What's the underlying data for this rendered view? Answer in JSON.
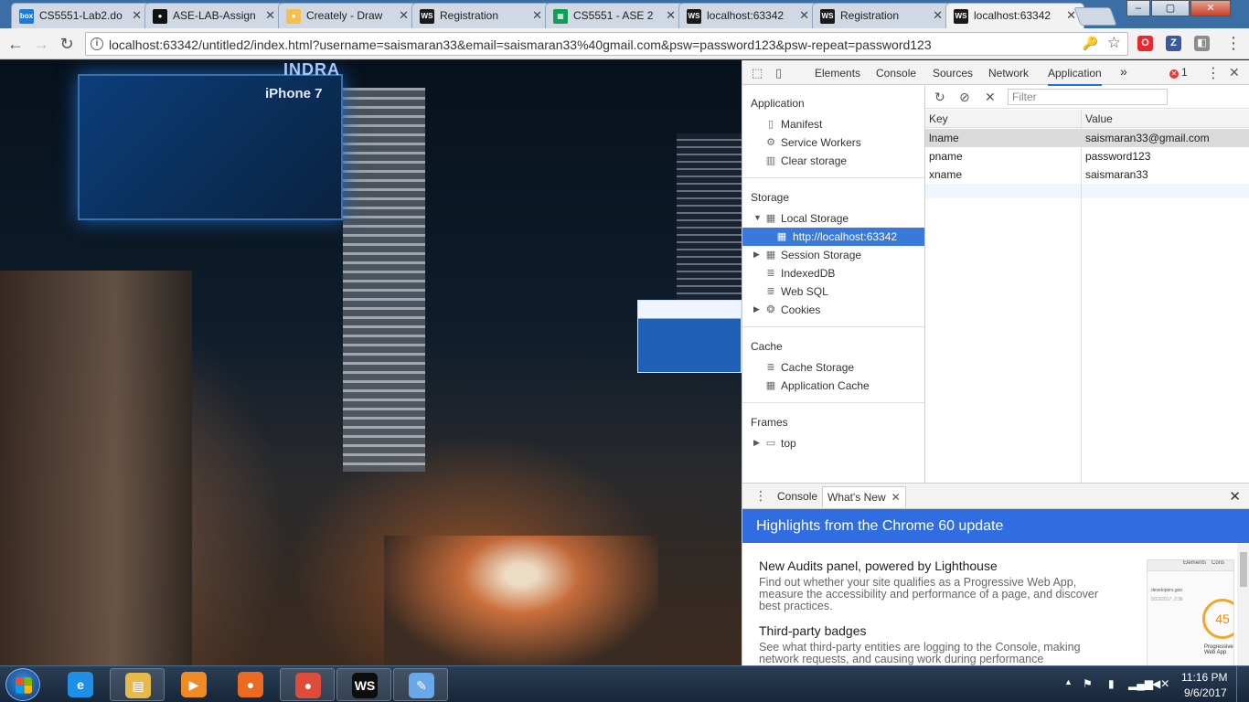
{
  "browser": {
    "tabs": [
      {
        "title": "CS5551-Lab2.do",
        "favicon": "box-icon",
        "color": "#1a7bd6",
        "glyph": "box",
        "active": false
      },
      {
        "title": "ASE-LAB-Assign",
        "favicon": "github-icon",
        "color": "#111111",
        "glyph": "●",
        "active": false
      },
      {
        "title": "Creately - Draw",
        "favicon": "creately-icon",
        "color": "#f2c14e",
        "glyph": "●",
        "active": false
      },
      {
        "title": "Registration",
        "favicon": "webstorm-icon",
        "color": "#1a1a1a",
        "glyph": "WS",
        "active": false
      },
      {
        "title": "CS5551 - ASE 2",
        "favicon": "sheets-icon",
        "color": "#0f9d58",
        "glyph": "▦",
        "active": false
      },
      {
        "title": "localhost:63342",
        "favicon": "webstorm-icon",
        "color": "#1a1a1a",
        "glyph": "WS",
        "active": false
      },
      {
        "title": "Registration",
        "favicon": "webstorm-icon",
        "color": "#1a1a1a",
        "glyph": "WS",
        "active": false
      },
      {
        "title": "localhost:63342",
        "favicon": "webstorm-icon",
        "color": "#1a1a1a",
        "glyph": "WS",
        "active": true
      }
    ],
    "url": "localhost:63342/untitled2/index.html?username=saismaran33&email=saismaran33%40gmail.com&psw=password123&psw-repeat=password123",
    "extensions": [
      {
        "name": "opera-icon",
        "glyph": "O",
        "color": "#e8282d"
      },
      {
        "name": "zotero-icon",
        "glyph": "Z",
        "color": "#3b5998"
      },
      {
        "name": "extension-icon",
        "glyph": "◧",
        "color": "#8c8c8c"
      }
    ]
  },
  "page": {
    "billboard_text": "iPhone 7",
    "building_sign": "INDRA"
  },
  "devtools": {
    "tabs": [
      "Elements",
      "Console",
      "Sources",
      "Network",
      "Application"
    ],
    "active_tab": "Application",
    "more_tabs": "»",
    "error_count": "1",
    "sidebar": {
      "application_header": "Application",
      "application_items": [
        {
          "label": "Manifest",
          "icon": "manifest-icon",
          "glyph": "▯"
        },
        {
          "label": "Service Workers",
          "icon": "gear-icon",
          "glyph": "⚙"
        },
        {
          "label": "Clear storage",
          "icon": "trash-icon",
          "glyph": "🗑"
        }
      ],
      "storage_header": "Storage",
      "local_storage": "Local Storage",
      "local_storage_origin": "http://localhost:63342",
      "session_storage": "Session Storage",
      "indexeddb": "IndexedDB",
      "websql": "Web SQL",
      "cookies": "Cookies",
      "cache_header": "Cache",
      "cache_storage": "Cache Storage",
      "application_cache": "Application Cache",
      "frames_header": "Frames",
      "frames_top": "top"
    },
    "storage_table": {
      "filter_placeholder": "Filter",
      "columns": [
        "Key",
        "Value"
      ],
      "rows": [
        {
          "key": "lname",
          "value": "saismaran33@gmail.com"
        },
        {
          "key": "pname",
          "value": "password123"
        },
        {
          "key": "xname",
          "value": "saismaran33"
        }
      ]
    },
    "drawer": {
      "tabs": [
        "Console",
        "What's New"
      ],
      "active_tab": "What's New",
      "banner": "Highlights from the Chrome 60 update",
      "items": [
        {
          "title": "New Audits panel, powered by Lighthouse",
          "text": "Find out whether your site qualifies as a Progressive Web App, measure the accessibility and performance of a page, and discover best practices."
        },
        {
          "title": "Third-party badges",
          "text": "See what third-party entities are logging to the Console, making network requests, and causing work during performance"
        }
      ],
      "thumb_tab": "Elements",
      "thumb_tab2": "Cons",
      "thumb_url": "developers.goo",
      "thumb_date": "5/23/2017, 2:36",
      "thumb_score": "45",
      "thumb_caption": "Progressive Web App"
    }
  },
  "taskbar": {
    "apps": [
      {
        "name": "internet-explorer-icon",
        "glyph": "e",
        "color": "#1f8fe6",
        "open": false
      },
      {
        "name": "file-explorer-icon",
        "glyph": "▤",
        "color": "#e5b94a",
        "open": true
      },
      {
        "name": "media-player-icon",
        "glyph": "▶",
        "color": "#f08a24",
        "open": false
      },
      {
        "name": "firefox-icon",
        "glyph": "●",
        "color": "#ea6a1f",
        "open": false
      },
      {
        "name": "chrome-icon",
        "glyph": "●",
        "color": "#dd4b39",
        "open": true
      },
      {
        "name": "webstorm-icon",
        "glyph": "WS",
        "color": "#0d0d0d",
        "open": true
      },
      {
        "name": "paint-icon",
        "glyph": "✎",
        "color": "#6aa7e8",
        "open": true
      }
    ],
    "time": "11:16 PM",
    "date": "9/6/2017"
  }
}
